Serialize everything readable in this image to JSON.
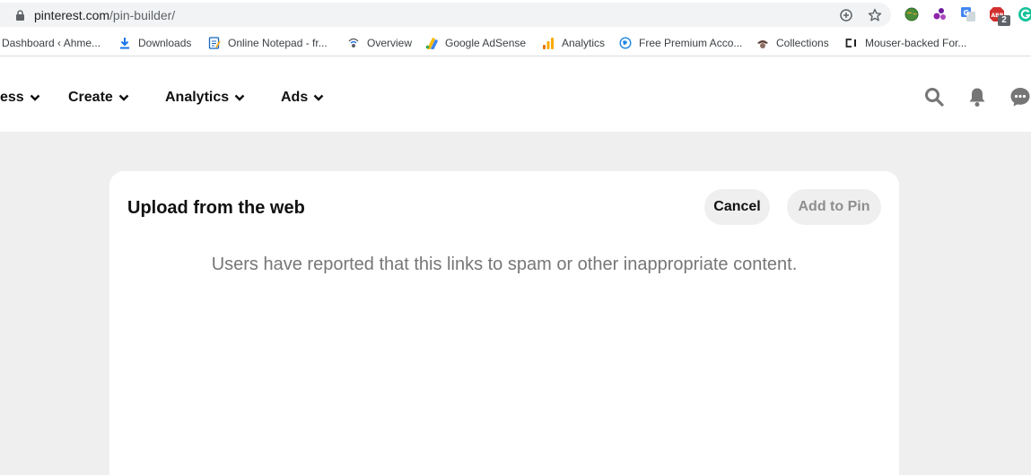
{
  "browser": {
    "url_host": "pinterest.com",
    "url_path": "/pin-builder/",
    "extension_badge": "2"
  },
  "bookmarks": [
    {
      "label": "Dashboard ‹ Ahme..."
    },
    {
      "label": "Downloads"
    },
    {
      "label": "Online Notepad - fr..."
    },
    {
      "label": "Overview"
    },
    {
      "label": "Google AdSense"
    },
    {
      "label": "Analytics"
    },
    {
      "label": "Free Premium Acco..."
    },
    {
      "label": "Collections"
    },
    {
      "label": "Mouser-backed For..."
    }
  ],
  "header": {
    "nav": [
      {
        "label": "ess"
      },
      {
        "label": "Create"
      },
      {
        "label": "Analytics"
      },
      {
        "label": "Ads"
      }
    ]
  },
  "modal": {
    "title": "Upload from the web",
    "cancel_label": "Cancel",
    "add_label": "Add to Pin",
    "message": "Users have reported that this links to spam or other inappropriate content."
  },
  "colors": {
    "page_bg": "#efefef",
    "button_bg": "#efefef",
    "message_text": "#767676",
    "disabled_text": "#8e8e8e"
  }
}
